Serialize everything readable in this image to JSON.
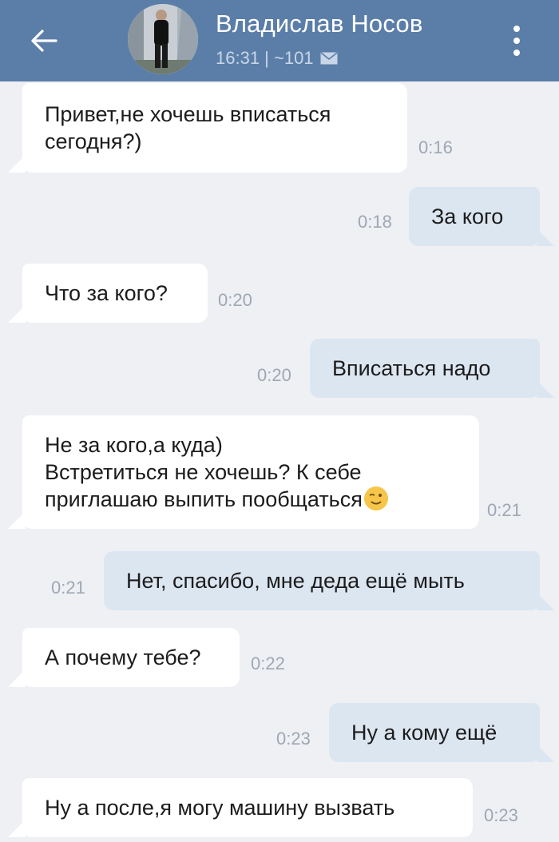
{
  "header": {
    "contact_name": "Владислав Носов",
    "status": "16:31 | ~101",
    "bg_color": "#5b7ea8"
  },
  "messages": [
    {
      "dir": "in",
      "lines": [
        "Привет,не хочешь вписаться",
        "сегодня?)"
      ],
      "time": "0:16"
    },
    {
      "dir": "out",
      "lines": [
        "За кого"
      ],
      "time": "0:18"
    },
    {
      "dir": "in",
      "lines": [
        "Что за кого?"
      ],
      "time": "0:20"
    },
    {
      "dir": "out",
      "lines": [
        "Вписаться надо"
      ],
      "time": "0:20"
    },
    {
      "dir": "in",
      "lines": [
        "Не за кого,а куда)",
        "Встретиться не хочешь? К себе",
        "приглашаю выпить пообщаться"
      ],
      "time": "0:21",
      "emoji": "wink-emoji"
    },
    {
      "dir": "out",
      "lines": [
        "Нет, спасибо, мне деда ещё мыть"
      ],
      "time": "0:21"
    },
    {
      "dir": "in",
      "lines": [
        "А почему тебе?"
      ],
      "time": "0:22"
    },
    {
      "dir": "out",
      "lines": [
        "Ну а кому ещё"
      ],
      "time": "0:23"
    },
    {
      "dir": "in",
      "lines": [
        "Ну а после,я могу машину вызвать"
      ],
      "time": "0:23"
    }
  ]
}
